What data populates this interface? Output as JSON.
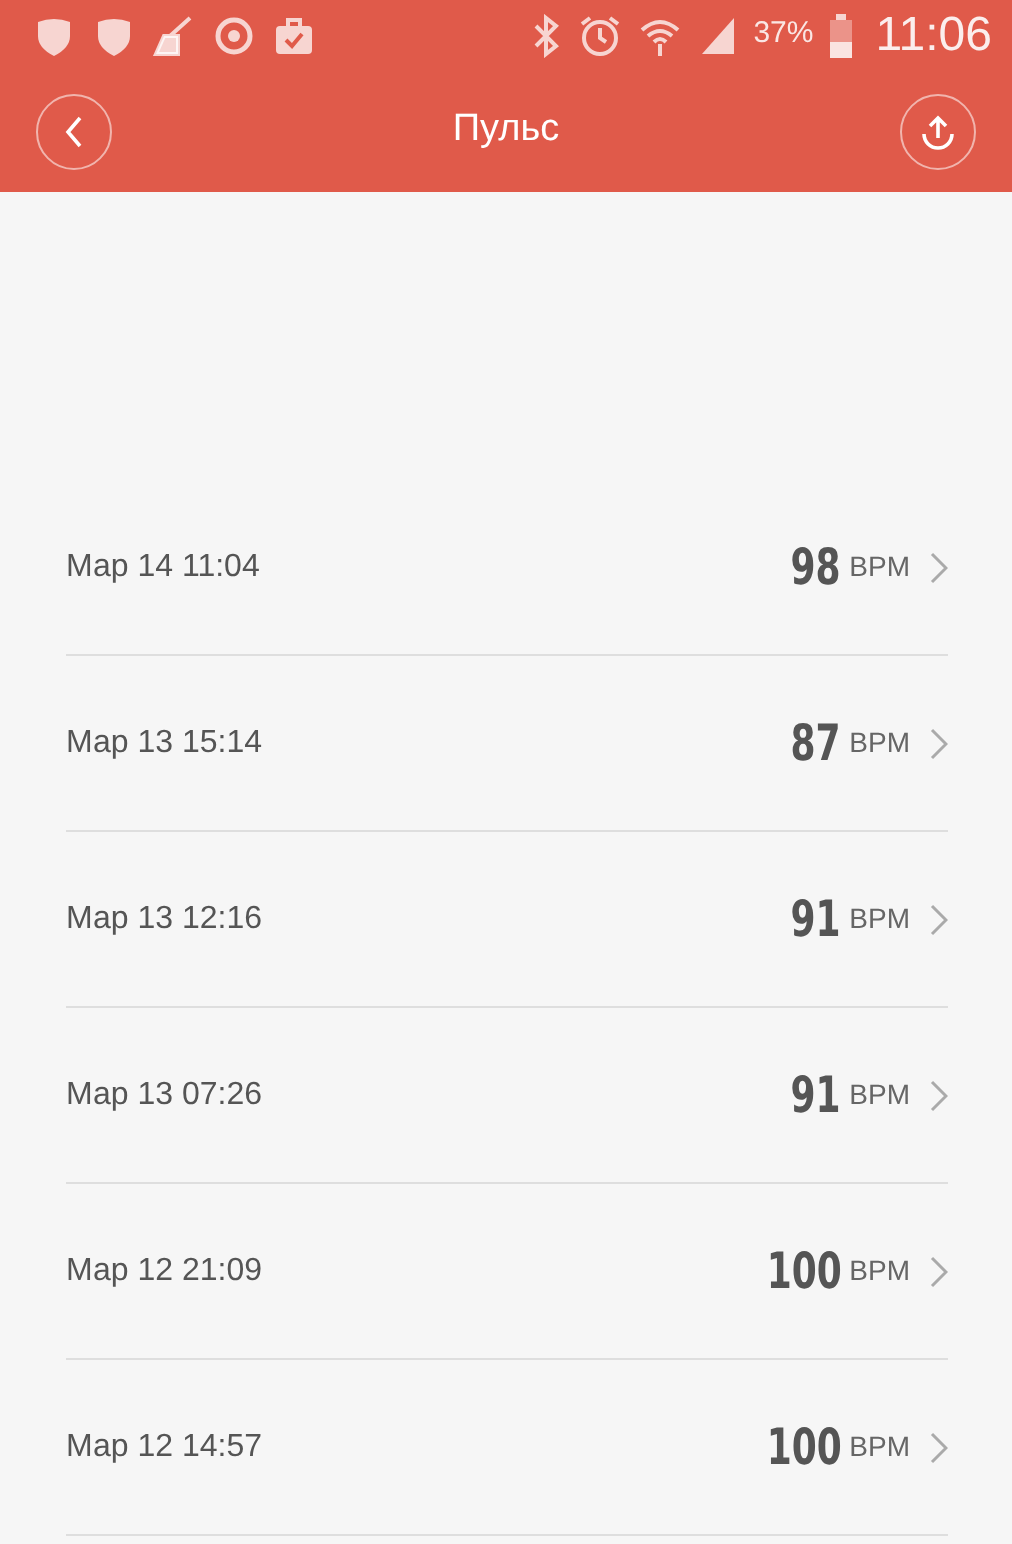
{
  "status_bar": {
    "battery_text": "37%",
    "time": "11:06"
  },
  "header": {
    "title": "Пульс"
  },
  "records": [
    {
      "date": "Мар 14 11:04",
      "value": "98",
      "unit": "BPM"
    },
    {
      "date": "Мар 13 15:14",
      "value": "87",
      "unit": "BPM"
    },
    {
      "date": "Мар 13 12:16",
      "value": "91",
      "unit": "BPM"
    },
    {
      "date": "Мар 13 07:26",
      "value": "91",
      "unit": "BPM"
    },
    {
      "date": "Мар 12 21:09",
      "value": "100",
      "unit": "BPM"
    },
    {
      "date": "Мар 12 14:57",
      "value": "100",
      "unit": "BPM"
    }
  ]
}
